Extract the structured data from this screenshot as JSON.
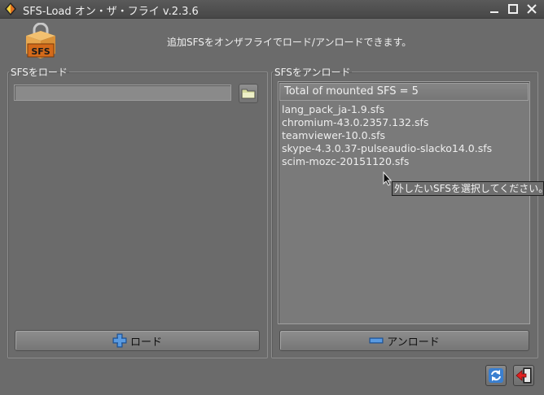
{
  "window": {
    "title": "SFS-Load オン・ザ・フライ v.2.3.6",
    "minimize_icon": "minimize-icon",
    "maximize_icon": "maximize-icon",
    "close_icon": "close-icon"
  },
  "header": {
    "logo_text": "SFS",
    "message": "追加SFSをオンザフライでロード/アンロードできます。"
  },
  "load_panel": {
    "legend": "SFSをロード",
    "path_value": "",
    "folder_icon": "folder-icon",
    "load_button_label": "ロード",
    "load_icon": "plus-icon"
  },
  "unload_panel": {
    "legend": "SFSをアンロード",
    "list_header": "Total of mounted SFS = 5",
    "items": [
      "lang_pack_ja-1.9.sfs",
      "chromium-43.0.2357.132.sfs",
      "teamviewer-10.0.sfs",
      "skype-4.3.0.37-pulseaudio-slacko14.0.sfs",
      "scim-mozc-20151120.sfs"
    ],
    "unload_button_label": "アンロード",
    "unload_icon": "minus-icon"
  },
  "tooltip": "外したいSFSを選択してください。",
  "footer": {
    "refresh_icon": "refresh-icon",
    "exit_icon": "exit-icon"
  },
  "colors": {
    "background": "#6b6b6b",
    "titlebar": "#4f4f4f",
    "accent_blue": "#3a7fd0",
    "logo_orange": "#e88a2a"
  }
}
